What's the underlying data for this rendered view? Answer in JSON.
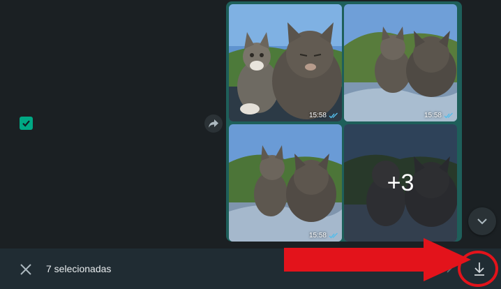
{
  "selection": {
    "count_label": "7 selecionadas"
  },
  "photos": [
    {
      "time": "15:58"
    },
    {
      "time": "15:58"
    },
    {
      "time": "15:58"
    }
  ],
  "more_overlay": "+3",
  "icons": {
    "checkbox": "check-icon",
    "forward": "forward-icon",
    "close": "close-icon",
    "download": "download-icon",
    "scroll": "chevron-down-icon",
    "read_receipt": "double-check-icon"
  },
  "colors": {
    "accent": "#00a884",
    "bubble": "#1e5f5a",
    "annotation": "#e3131b",
    "read_receipt": "#53bdeb"
  }
}
